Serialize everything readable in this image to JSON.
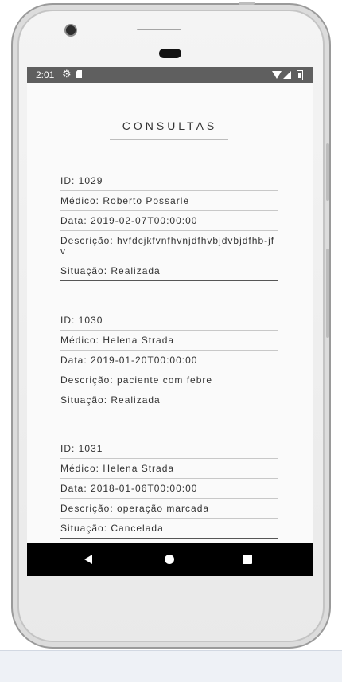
{
  "status_bar": {
    "time": "2:01",
    "icons": [
      "gear-icon",
      "sd-card-icon",
      "wifi-icon",
      "signal-icon",
      "battery-icon"
    ]
  },
  "page": {
    "title": "CONSULTAS"
  },
  "records": [
    {
      "id": "ID: 1029",
      "medico": "Médico: Roberto Possarle",
      "data": "Data: 2019-02-07T00:00:00",
      "descricao": "Descrição: hvfdcjkfvnfhvnjdfhvbjdvbjdfhb-jfv",
      "situacao": "Situação: Realizada"
    },
    {
      "id": "ID: 1030",
      "medico": "Médico: Helena Strada",
      "data": "Data: 2019-01-20T00:00:00",
      "descricao": "Descrição: paciente com febre",
      "situacao": "Situação: Realizada"
    },
    {
      "id": "ID: 1031",
      "medico": "Médico: Helena Strada",
      "data": "Data: 2018-01-06T00:00:00",
      "descricao": "Descrição: operação marcada",
      "situacao": "Situação: Cancelada"
    }
  ],
  "nav_bar": {
    "icons": [
      "back-icon",
      "home-icon",
      "recents-icon"
    ]
  }
}
